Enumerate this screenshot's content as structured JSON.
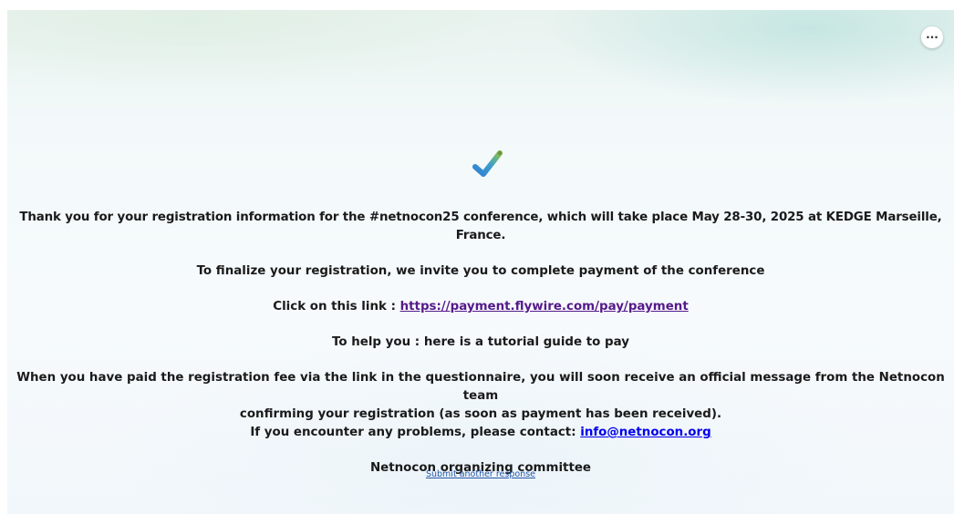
{
  "menu": {
    "more_label": "···"
  },
  "icons": {
    "success": "checkmark-icon",
    "more": "ellipsis-icon"
  },
  "colors": {
    "link": "#0000ee",
    "visited_link": "#551a8b",
    "check_blue": "#2f7fd6",
    "check_green": "#8bc34a"
  },
  "message": {
    "thanks": "Thank you for your registration information for the #netnocon25 conference, which will take place May 28-30, 2025 at KEDGE Marseille, France.",
    "finalize": "To finalize your registration, we invite you to complete payment of the conference",
    "click_prefix": "Click on this link : ",
    "payment_link": "https://payment.flywire.com/pay/payment",
    "tutorial": "To help you : here is a tutorial guide to pay",
    "paid_line1": "When you have paid the registration fee via the link in the questionnaire, you will soon receive an official message from the Netnocon team",
    "paid_line2": "confirming your registration (as soon as payment has been received).",
    "contact_prefix": "If you encounter any problems, please contact: ",
    "contact_email": "info@netnocon.org",
    "signature": "Netnocon organizing committee"
  },
  "footer": {
    "submit_another": "Submit another response"
  }
}
